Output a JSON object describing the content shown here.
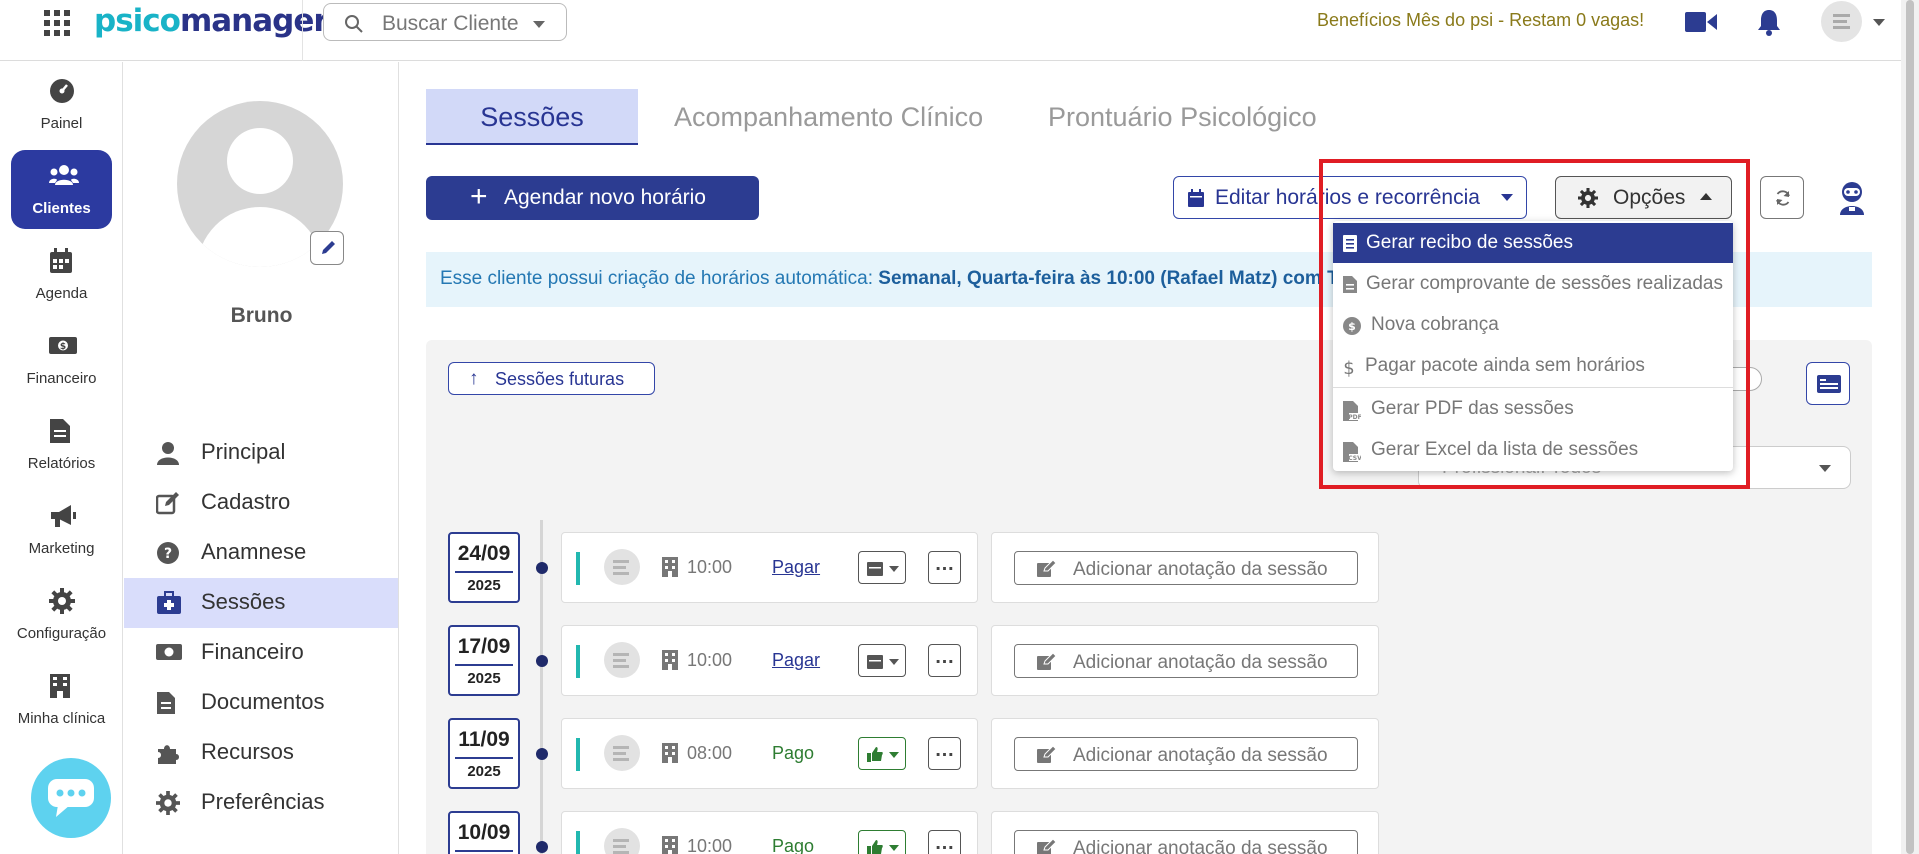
{
  "topbar": {
    "logo_a": "psico",
    "logo_b": "manager",
    "search_placeholder": "Buscar Cliente",
    "promo": "Benefícios Mês do psi - Restam 0 vagas!"
  },
  "leftnav": {
    "items": [
      {
        "label": "Painel",
        "icon": "dashboard-icon"
      },
      {
        "label": "Clientes",
        "icon": "users-icon",
        "active": true
      },
      {
        "label": "Agenda",
        "icon": "calendar-icon"
      },
      {
        "label": "Financeiro",
        "icon": "money-icon"
      },
      {
        "label": "Relatórios",
        "icon": "document-icon"
      },
      {
        "label": "Marketing",
        "icon": "megaphone-icon"
      },
      {
        "label": "Configuração",
        "icon": "gear-icon"
      },
      {
        "label": "Minha clínica",
        "icon": "building-icon"
      }
    ]
  },
  "client": {
    "name": "Bruno",
    "menu": [
      {
        "label": "Principal"
      },
      {
        "label": "Cadastro"
      },
      {
        "label": "Anamnese"
      },
      {
        "label": "Sessões",
        "active": true
      },
      {
        "label": "Financeiro"
      },
      {
        "label": "Documentos"
      },
      {
        "label": "Recursos"
      },
      {
        "label": "Preferências"
      }
    ]
  },
  "tabs": [
    "Sessões",
    "Acompanhamento Clínico",
    "Prontuário Psicológico"
  ],
  "actions": {
    "agendar": "Agendar novo horário",
    "editar": "Editar horários e recorrência",
    "opcoes": "Opções"
  },
  "info": {
    "prefix": "Esse cliente possui criação de horários automática: ",
    "bold": "Semanal, Quarta-feira às 10:00 (Rafael Matz) com T"
  },
  "filters": {
    "futuras": "Sessões futuras",
    "profissional": "Profissional: Todos"
  },
  "dropdown": {
    "items": [
      {
        "label": "Gerar recibo de sessões",
        "icon": "receipt-icon",
        "active": true
      },
      {
        "label": "Gerar comprovante de sessões realizadas",
        "icon": "file-icon"
      },
      {
        "label": "Nova cobrança",
        "icon": "money-circle-icon"
      },
      {
        "label": "Pagar pacote ainda sem horários",
        "icon": "dollar-icon"
      },
      {
        "label": "Gerar PDF das sessões",
        "icon": "pdf-icon"
      },
      {
        "label": "Gerar Excel da lista de sessões",
        "icon": "csv-icon"
      }
    ]
  },
  "sessions": [
    {
      "day": "24/09",
      "year": "2025",
      "time": "10:00",
      "payment": "Pagar",
      "paid": false
    },
    {
      "day": "17/09",
      "year": "2025",
      "time": "10:00",
      "payment": "Pagar",
      "paid": false
    },
    {
      "day": "11/09",
      "year": "2025",
      "time": "08:00",
      "payment": "Pago",
      "paid": true
    },
    {
      "day": "10/09",
      "year": "",
      "time": "10:00",
      "payment": "Pago",
      "paid": true
    }
  ],
  "note_button": "Adicionar anotação da sessão",
  "colors": {
    "primary": "#2c3c91",
    "accent_teal": "#19b3c7",
    "active_light": "#d9ddfb",
    "highlight_red": "#e01d24",
    "paid_green": "#2e7d32",
    "promo": "#8a7a1a"
  }
}
